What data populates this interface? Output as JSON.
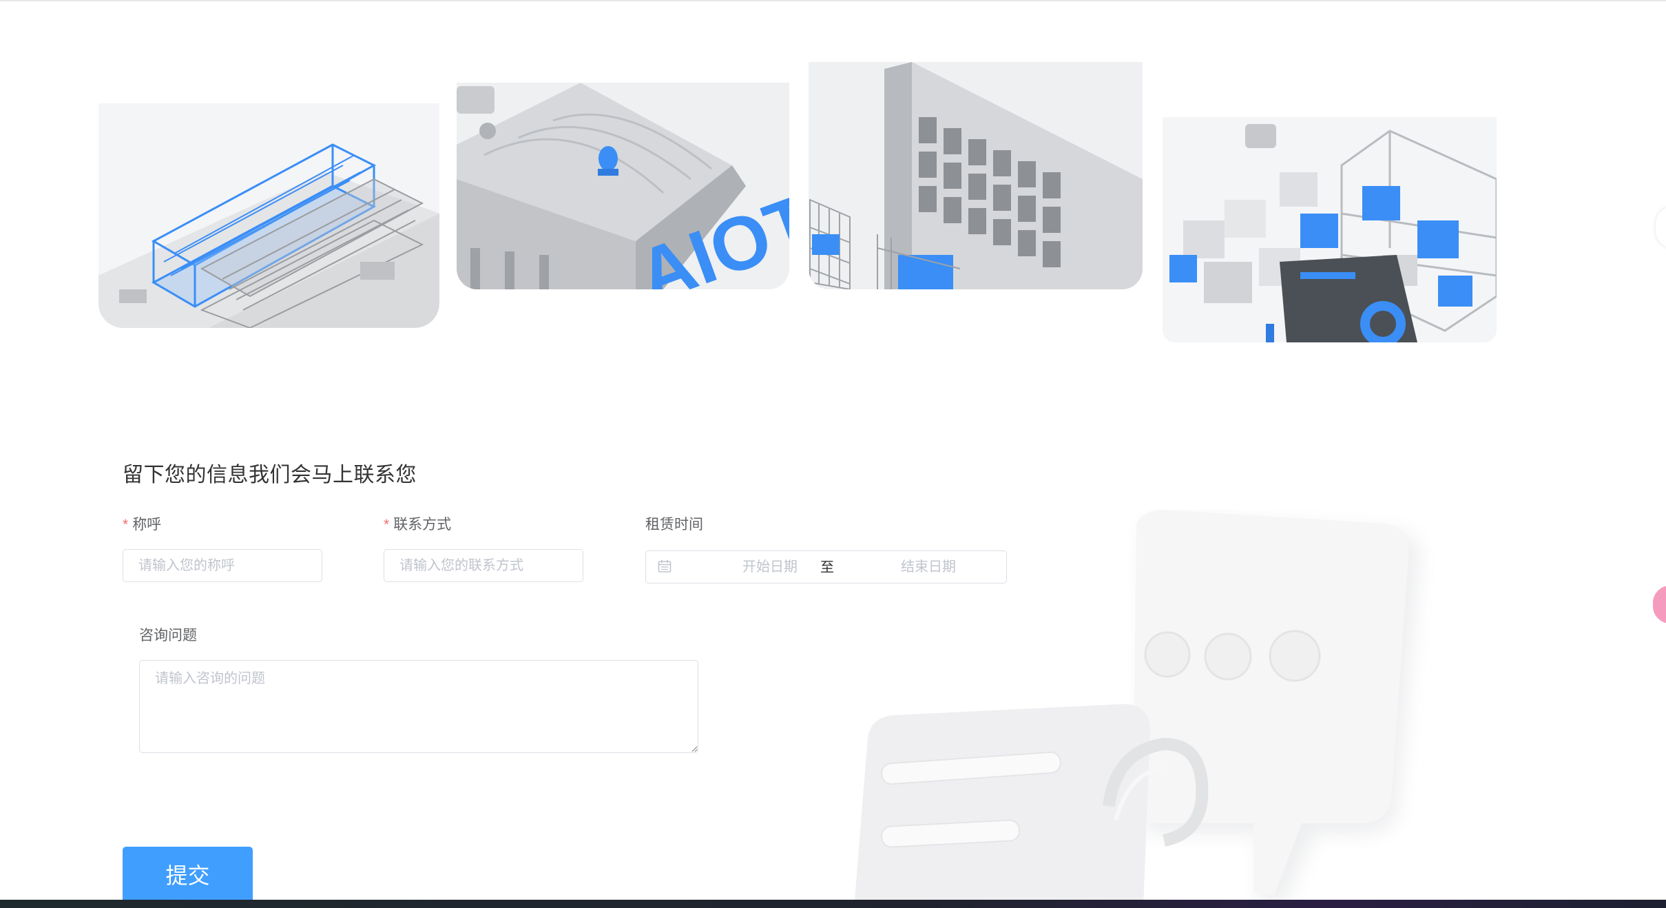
{
  "gallery": {
    "items": [
      {
        "icon": "warehouse-racks-illustration"
      },
      {
        "icon": "aiot-warehouse-illustration",
        "text": "AIOT"
      },
      {
        "icon": "storage-locker-illustration"
      },
      {
        "icon": "logistics-boxes-illustration"
      }
    ]
  },
  "form": {
    "title": "留下您的信息我们会马上联系您",
    "name": {
      "label": "称呼",
      "required_mark": "*",
      "placeholder": "请输入您的称呼"
    },
    "contact": {
      "label": "联系方式",
      "required_mark": "*",
      "placeholder": "请输入您的联系方式"
    },
    "rental_time": {
      "label": "租赁时间",
      "start_placeholder": "开始日期",
      "separator": "至",
      "end_placeholder": "结束日期",
      "icon": "calendar-icon"
    },
    "question": {
      "label": "咨询问题",
      "placeholder": "请输入咨询的问题"
    },
    "submit_label": "提交"
  },
  "decoration": {
    "icon": "chat-bubbles-illustration"
  },
  "colors": {
    "accent": "#409eff",
    "required": "#f56c6c",
    "illustration_blue": "#3a8ef6",
    "border": "#dcdfe6"
  }
}
